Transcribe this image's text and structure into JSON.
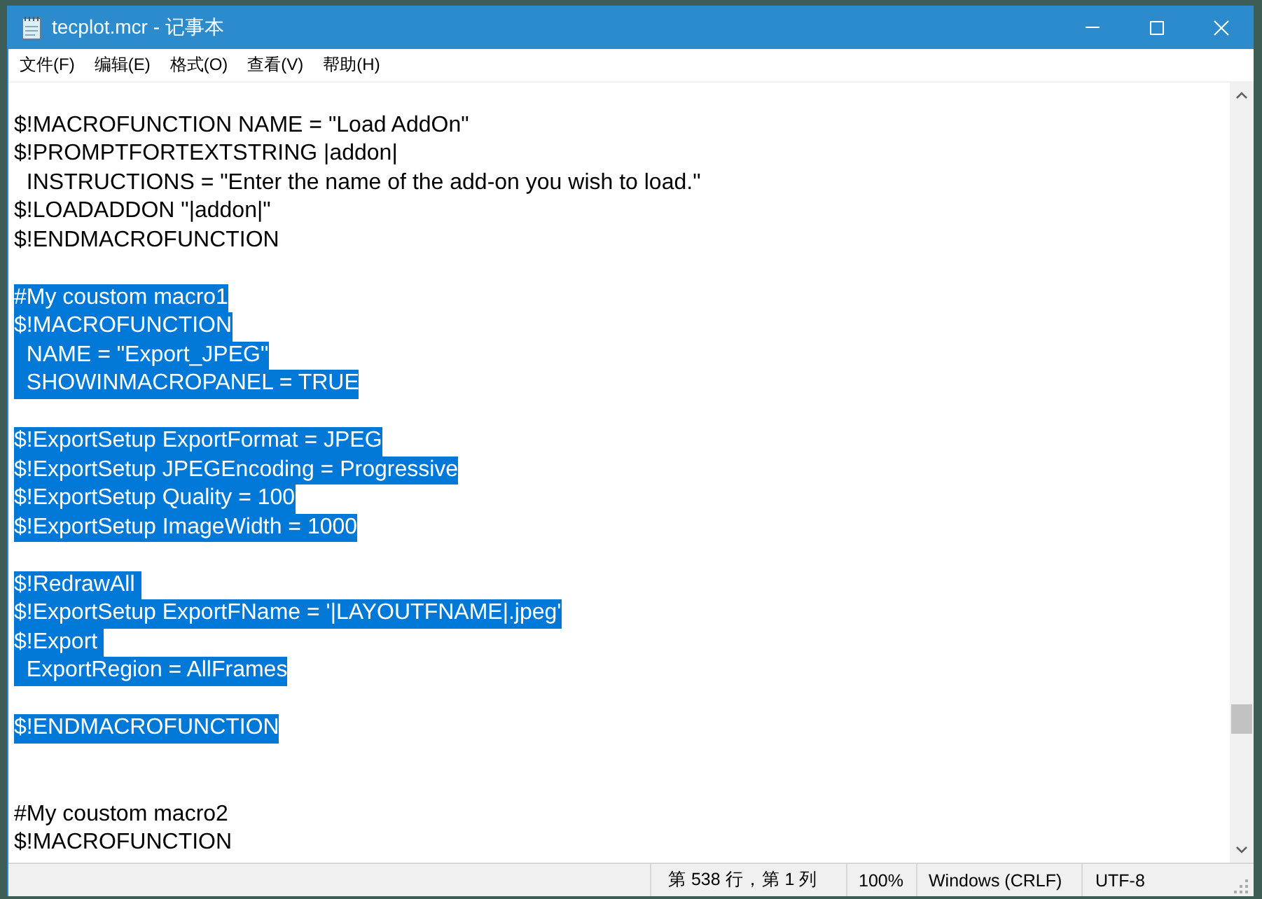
{
  "window": {
    "title": "tecplot.mcr - 记事本"
  },
  "menu": [
    "文件(F)",
    "编辑(E)",
    "格式(O)",
    "查看(V)",
    "帮助(H)"
  ],
  "lines": [
    {
      "kind": "blank"
    },
    {
      "kind": "text",
      "text": "$!MACROFUNCTION NAME = \"Load AddOn\"",
      "selected": false
    },
    {
      "kind": "text",
      "text": "$!PROMPTFORTEXTSTRING |addon|",
      "selected": false
    },
    {
      "kind": "text",
      "text": "  INSTRUCTIONS = \"Enter the name of the add-on you wish to load.\"",
      "selected": false
    },
    {
      "kind": "text",
      "text": "$!LOADADDON \"|addon|\"",
      "selected": false
    },
    {
      "kind": "text",
      "text": "$!ENDMACROFUNCTION",
      "selected": false
    },
    {
      "kind": "blank"
    },
    {
      "kind": "text",
      "text": "#My coustom macro1",
      "selected": true
    },
    {
      "kind": "text",
      "text": "$!MACROFUNCTION",
      "selected": true
    },
    {
      "kind": "text",
      "text": "  NAME = \"Export_JPEG\"",
      "selected": true
    },
    {
      "kind": "text",
      "text": "  SHOWINMACROPANEL = TRUE",
      "selected": true
    },
    {
      "kind": "blank"
    },
    {
      "kind": "text",
      "text": "$!ExportSetup ExportFormat = JPEG",
      "selected": true
    },
    {
      "kind": "text",
      "text": "$!ExportSetup JPEGEncoding = Progressive",
      "selected": true
    },
    {
      "kind": "text",
      "text": "$!ExportSetup Quality = 100",
      "selected": true
    },
    {
      "kind": "text",
      "text": "$!ExportSetup ImageWidth = 1000",
      "selected": true
    },
    {
      "kind": "blank"
    },
    {
      "kind": "text",
      "text": "$!RedrawAll ",
      "selected": true
    },
    {
      "kind": "text",
      "text": "$!ExportSetup ExportFName = '|LAYOUTFNAME|.jpeg'",
      "selected": true
    },
    {
      "kind": "text",
      "text": "$!Export ",
      "selected": true
    },
    {
      "kind": "text",
      "text": "  ExportRegion = AllFrames",
      "selected": true
    },
    {
      "kind": "blank"
    },
    {
      "kind": "text",
      "text": "$!ENDMACROFUNCTION",
      "selected": true
    },
    {
      "kind": "blank"
    },
    {
      "kind": "blank"
    },
    {
      "kind": "text",
      "text": "#My coustom macro2",
      "selected": false
    },
    {
      "kind": "text",
      "text": "$!MACROFUNCTION",
      "selected": false
    }
  ],
  "status_bar": [
    "第 538 行，第 1 列",
    "100%",
    "Windows (CRLF)",
    "UTF-8"
  ]
}
